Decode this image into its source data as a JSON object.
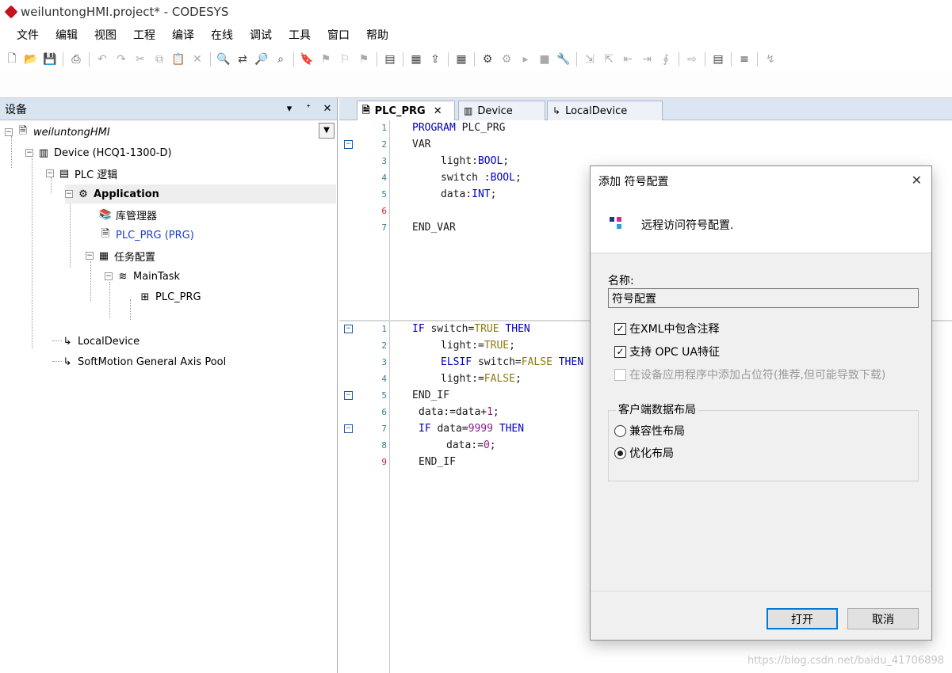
{
  "window": {
    "title": "weiluntongHMI.project* - CODESYS"
  },
  "menu": [
    "文件",
    "编辑",
    "视图",
    "工程",
    "编译",
    "在线",
    "调试",
    "工具",
    "窗口",
    "帮助"
  ],
  "devices_pane": {
    "title": "设备",
    "pin": "▾",
    "dock": "ᐩ",
    "close": "✕",
    "tree": [
      {
        "label": "weiluntongHMI"
      },
      {
        "label": "Device (HCQ1-1300-D)"
      },
      {
        "label": "PLC 逻辑"
      },
      {
        "label": "Application"
      },
      {
        "label": "库管理器"
      },
      {
        "label": "PLC_PRG (PRG)"
      },
      {
        "label": "任务配置"
      },
      {
        "label": "MainTask"
      },
      {
        "label": "PLC_PRG"
      },
      {
        "label": "LocalDevice"
      },
      {
        "label": "SoftMotion General Axis Pool"
      }
    ]
  },
  "editor": {
    "tabs": [
      {
        "label": "PLC_PRG",
        "close": "✕"
      },
      {
        "label": "Device"
      },
      {
        "label": "LocalDevice"
      }
    ],
    "decl_lines": [
      {
        "n": "1",
        "code": "PROGRAM PLC_PRG"
      },
      {
        "n": "2",
        "code": "VAR"
      },
      {
        "n": "3",
        "code": "light:BOOL;"
      },
      {
        "n": "4",
        "code": "switch :BOOL;"
      },
      {
        "n": "5",
        "code": "data:INT;"
      },
      {
        "n": "6",
        "code": ""
      },
      {
        "n": "7",
        "code": "END_VAR"
      }
    ],
    "impl_lines": [
      {
        "n": "1",
        "code": "IF switch=TRUE THEN"
      },
      {
        "n": "2",
        "code": "light:=TRUE;"
      },
      {
        "n": "3",
        "code": "ELSIF switch=FALSE THEN"
      },
      {
        "n": "4",
        "code": "light:=FALSE;"
      },
      {
        "n": "5",
        "code": "END_IF"
      },
      {
        "n": "6",
        "code": "data:=data+1;"
      },
      {
        "n": "7",
        "code": "IF data=9999 THEN"
      },
      {
        "n": "8",
        "code": "data:=0;"
      },
      {
        "n": "9",
        "code": "END_IF"
      }
    ]
  },
  "dialog": {
    "title": "添加 符号配置",
    "close": "✕",
    "description": "远程访问符号配置.",
    "name_label": "名称:",
    "name_value": "符号配置",
    "checkboxes": [
      {
        "label": "在XML中包含注释",
        "checked": true,
        "mark": "✓"
      },
      {
        "label": "支持 OPC UA特征",
        "checked": true,
        "mark": "✓"
      },
      {
        "label": "在设备应用程序中添加占位符(推荐,但可能导致下载)",
        "checked": false,
        "enabled": false
      }
    ],
    "layout_group": {
      "title": "客户端数据布局",
      "options": [
        {
          "label": "兼容性布局",
          "selected": false
        },
        {
          "label": "优化布局",
          "selected": true
        }
      ]
    },
    "buttons": {
      "open": "打开",
      "cancel": "取消"
    }
  },
  "watermark": "https://blog.csdn.net/baidu_41706898",
  "colors": {
    "keyword": "#0000c0",
    "literal": "#8b7a12",
    "number": "#8b1a8b",
    "link": "#1a3fcc",
    "pane_header": "#d9e4f1",
    "primary_button_border": "#0078d7"
  }
}
